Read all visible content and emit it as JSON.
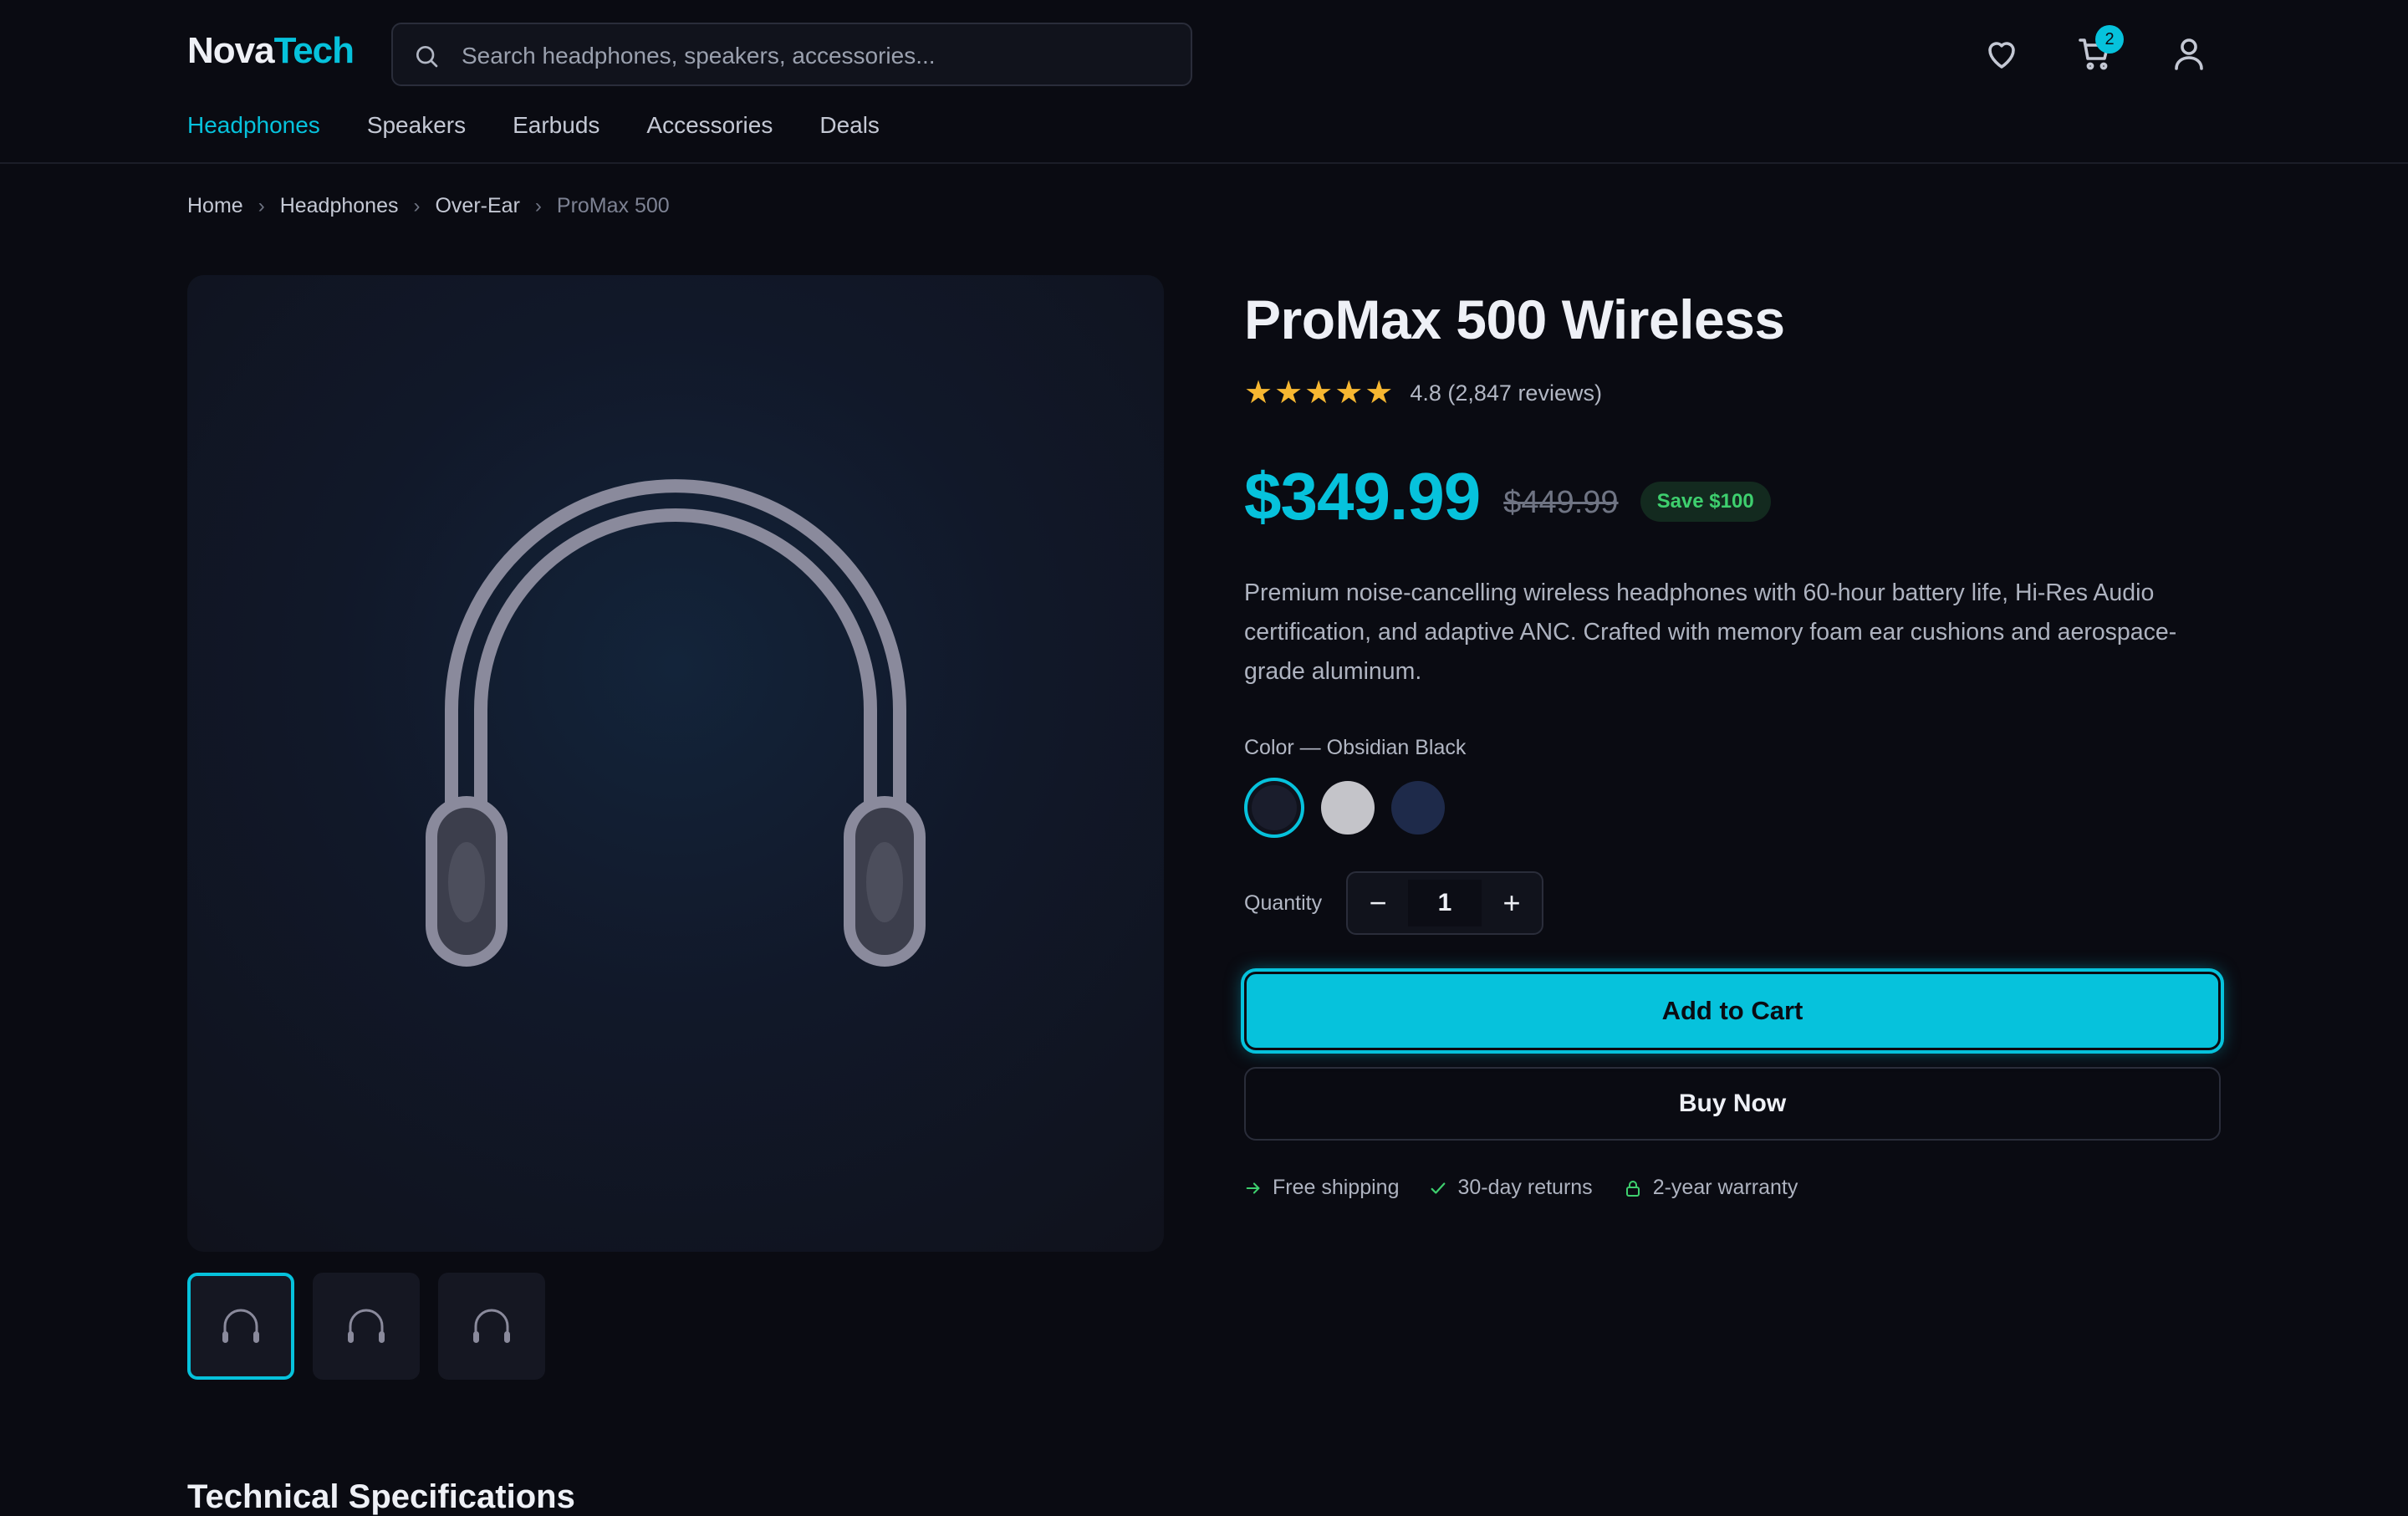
{
  "logo": {
    "part1": "Nova",
    "part2": "Tech"
  },
  "search": {
    "placeholder": "Search headphones, speakers, accessories..."
  },
  "header": {
    "cart_count": "2"
  },
  "nav": [
    "Headphones",
    "Speakers",
    "Earbuds",
    "Accessories",
    "Deals"
  ],
  "breadcrumb": [
    "Home",
    "Headphones",
    "Over-Ear",
    "ProMax 500"
  ],
  "product": {
    "title": "ProMax 500 Wireless",
    "stars": "★★★★★",
    "rating_text": "4.8 (2,847 reviews)",
    "price": "$349.99",
    "old_price": "$449.99",
    "save_badge": "Save $100",
    "description": "Premium noise-cancelling wireless headphones with 60-hour battery life, Hi-Res Audio certification, and adaptive ANC. Crafted with memory foam ear cushions and aerospace-grade aluminum.",
    "color_label": "Color — Obsidian Black",
    "colors": [
      "#1a1d2c",
      "#c4c4c9",
      "#1e2a4a"
    ],
    "quantity_label": "Quantity",
    "quantity": "1",
    "add_to_cart": "Add to Cart",
    "buy_now": "Buy Now",
    "perks": [
      "Free shipping",
      "30-day returns",
      "2-year warranty"
    ]
  },
  "section": {
    "specs_title": "Technical Specifications"
  },
  "colors": {
    "accent": "#06c2dc",
    "background": "#0a0b12",
    "star": "#f7b731",
    "success": "#3ecf6e"
  }
}
